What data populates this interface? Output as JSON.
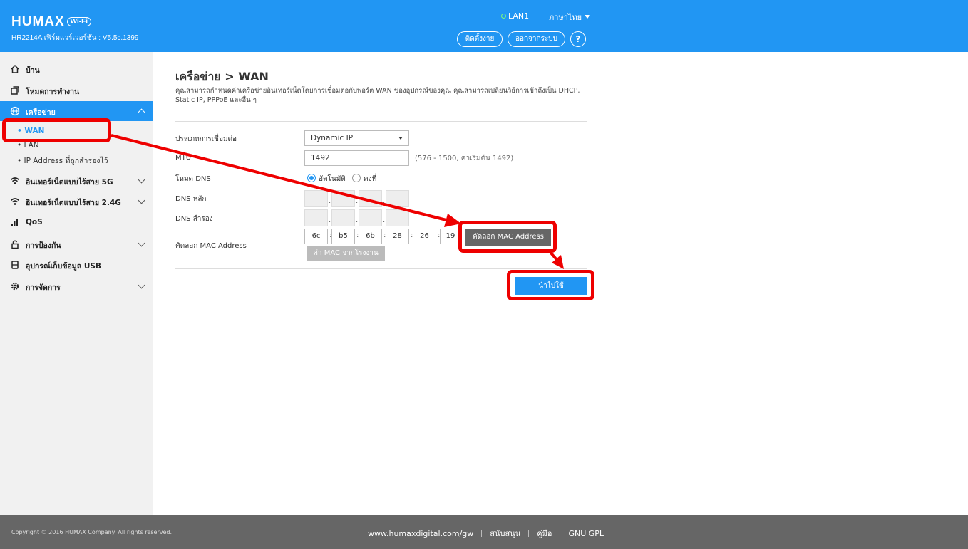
{
  "header": {
    "logo": "HUMAX",
    "logo_badge": "Wi-Fi",
    "firmware": "HR2214A เฟิร์มแวร์เวอร์ชัน : V5.5c.1399",
    "lan_status": "LAN1",
    "language": "ภาษาไทย",
    "setup_button": "ติดตั้งง่าย",
    "logout_button": "ออกจากระบบ",
    "help_button": "?"
  },
  "sidebar": {
    "items": [
      {
        "label": "บ้าน",
        "icon": "home-icon"
      },
      {
        "label": "โหมดการทำงาน",
        "icon": "window-icon"
      },
      {
        "label": "เครือข่าย",
        "icon": "globe-icon"
      },
      {
        "label": "อินเทอร์เน็ตแบบไร้สาย 5G",
        "icon": "wifi-icon"
      },
      {
        "label": "อินเทอร์เน็ตแบบไร้สาย 2.4G",
        "icon": "wifi-icon"
      },
      {
        "label": "QoS",
        "icon": "bars-icon"
      },
      {
        "label": "การป้องกัน",
        "icon": "lock-icon"
      },
      {
        "label": "อุปกรณ์เก็บข้อมูล USB",
        "icon": "usb-icon"
      },
      {
        "label": "การจัดการ",
        "icon": "gear-icon"
      }
    ],
    "sub_items": [
      "• WAN",
      "• LAN",
      "• IP Address ที่ถูกสำรองไว้"
    ]
  },
  "main": {
    "title": "เครือข่าย > WAN",
    "description": "คุณสามารถกำหนดค่าเครือข่ายอินเทอร์เน็ตโดยการเชื่อมต่อกับพอร์ต WAN ของอุปกรณ์ของคุณ คุณสามารถเปลี่ยนวิธีการเข้าถึงเป็น DHCP, Static IP, PPPoE และอื่น ๆ",
    "connection_type_label": "ประเภทการเชื่อมต่อ",
    "connection_type_value": "Dynamic IP",
    "mtu_label": "MTU",
    "mtu_value": "1492",
    "mtu_hint": "(576 - 1500, ค่าเริ่มต้น 1492)",
    "dns_mode_label": "โหมด DNS",
    "dns_auto": "อัตโนมัติ",
    "dns_static": "คงที่",
    "dns_primary_label": "DNS หลัก",
    "dns_secondary_label": "DNS สำรอง",
    "mac_clone_label": "คัดลอก MAC Address",
    "mac": [
      "6c",
      "b5",
      "6b",
      "28",
      "26",
      "19"
    ],
    "copy_mac_button": "คัดลอก MAC Address",
    "factory_mac_button": "ค่า MAC จากโรงงาน",
    "apply_button": "นำไปใช้"
  },
  "footer": {
    "copyright": "Copyright © 2016 HUMAX Company. All rights reserved.",
    "website": "www.humaxdigital.com/gw",
    "support": "สนับสนุน",
    "manual": "คู่มือ",
    "gpl": "GNU GPL"
  },
  "colors": {
    "accent": "#2196f3",
    "annotation": "#ee0000",
    "footer": "#666666"
  }
}
